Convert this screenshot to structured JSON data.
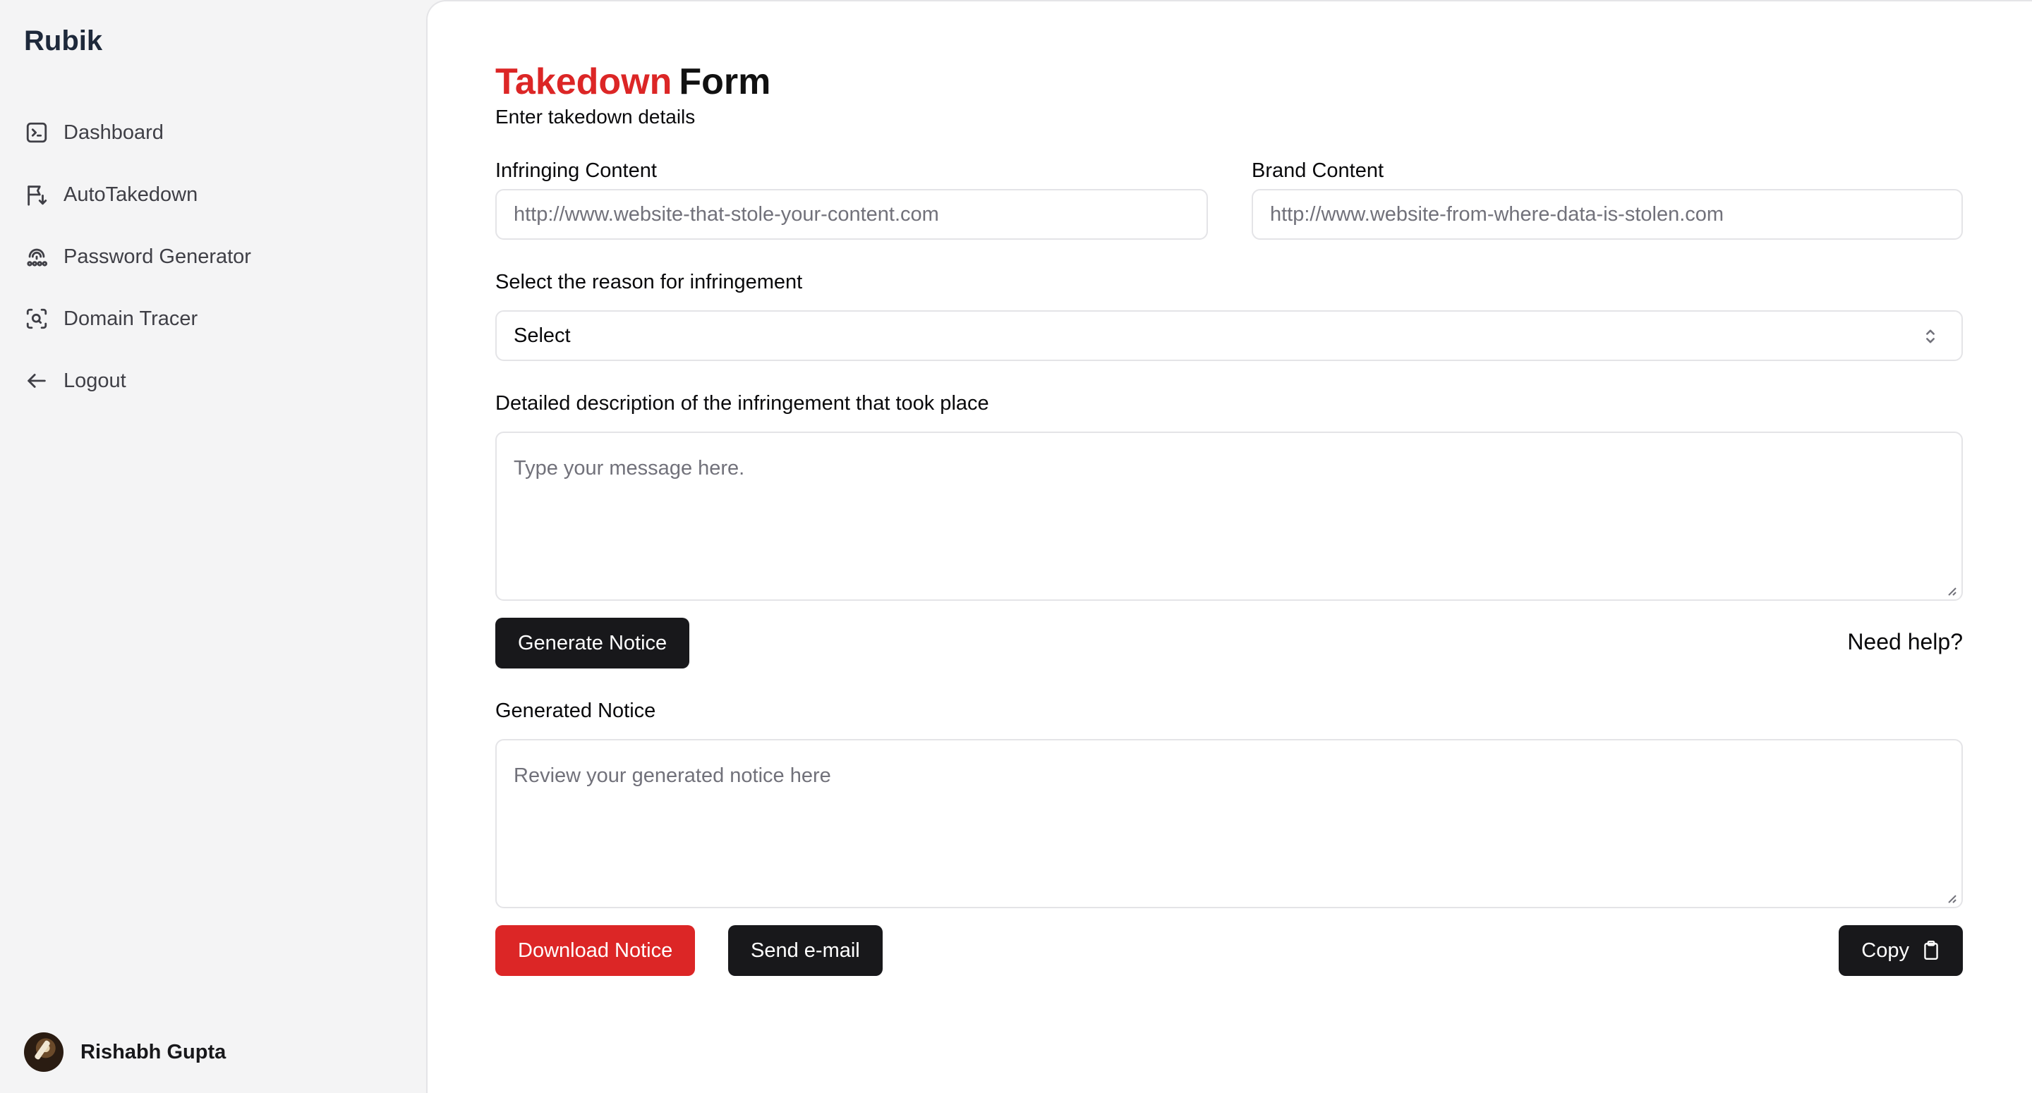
{
  "sidebar": {
    "brand": "Rubik",
    "items": [
      {
        "label": "Dashboard",
        "icon": "terminal-square-icon"
      },
      {
        "label": "AutoTakedown",
        "icon": "flag-arrow-down-icon"
      },
      {
        "label": "Password Generator",
        "icon": "fingerprint-icon"
      },
      {
        "label": "Domain Tracer",
        "icon": "scan-search-icon"
      },
      {
        "label": "Logout",
        "icon": "arrow-left-icon"
      }
    ],
    "user": {
      "name": "Rishabh Gupta"
    }
  },
  "form": {
    "title_accent": "Takedown",
    "title_rest": "Form",
    "subtitle": "Enter takedown details",
    "infringing_label": "Infringing Content",
    "infringing_placeholder": "http://www.website-that-stole-your-content.com",
    "brand_label": "Brand Content",
    "brand_placeholder": "http://www.website-from-where-data-is-stolen.com",
    "reason_label": "Select the reason for infringement",
    "reason_value": "Select",
    "description_label": "Detailed description of the infringement that took place",
    "description_placeholder": "Type your message here.",
    "generate_button": "Generate Notice",
    "help_link": "Need help?",
    "notice_label": "Generated Notice",
    "notice_placeholder": "Review your generated notice here",
    "download_button": "Download Notice",
    "email_button": "Send e-mail",
    "copy_button": "Copy"
  },
  "colors": {
    "accent": "#dc2626",
    "dark_button": "#18181b"
  }
}
